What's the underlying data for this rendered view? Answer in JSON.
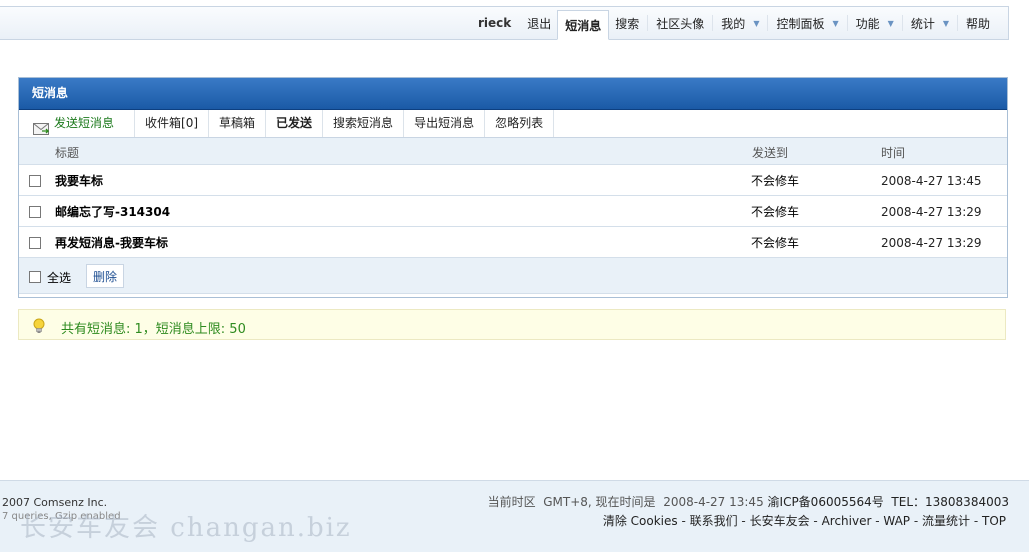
{
  "nav": {
    "user": "rieck",
    "logout": "退出",
    "pm": "短消息",
    "search": "搜索",
    "avatar": "社区头像",
    "mine": "我的",
    "control": "控制面板",
    "functions": "功能",
    "stats": "统计",
    "help": "帮助"
  },
  "box": {
    "title": "短消息",
    "tabs": [
      "发送短消息",
      "收件箱[0]",
      "草稿箱",
      "已发送",
      "搜索短消息",
      "导出短消息",
      "忽略列表"
    ],
    "active_tab": "已发送"
  },
  "table": {
    "headers": {
      "title": "标题",
      "to": "发送到",
      "time": "时间"
    },
    "rows": [
      {
        "title": "我要车标",
        "to": "不会修车",
        "time": "2008-4-27 13:45"
      },
      {
        "title": "邮编忘了写-314304",
        "to": "不会修车",
        "time": "2008-4-27 13:29"
      },
      {
        "title": "再发短消息-我要车标",
        "to": "不会修车",
        "time": "2008-4-27 13:29"
      }
    ],
    "select_all": "全选",
    "delete": "删除"
  },
  "notice": "共有短消息: 1，短消息上限: 50",
  "footer": {
    "copyright": "2007 Comsenz Inc.",
    "queries": "7 queries, Gzip enabled",
    "timezone_label": "当前时区",
    "timezone": "GMT+8, 现在时间是",
    "now": "2008-4-27 13:45",
    "icp": "渝ICP备06005564号",
    "tel": "TEL：13808384003",
    "links": [
      "清除 Cookies",
      "联系我们",
      "长安车友会",
      "Archiver",
      "WAP",
      "流量统计",
      "TOP"
    ]
  },
  "watermark": "长安车友会 changan.biz",
  "colors": {
    "header_blue": "#1b5aa6",
    "notice_green": "#2e8b1f",
    "link_blue": "#1e4f92"
  }
}
